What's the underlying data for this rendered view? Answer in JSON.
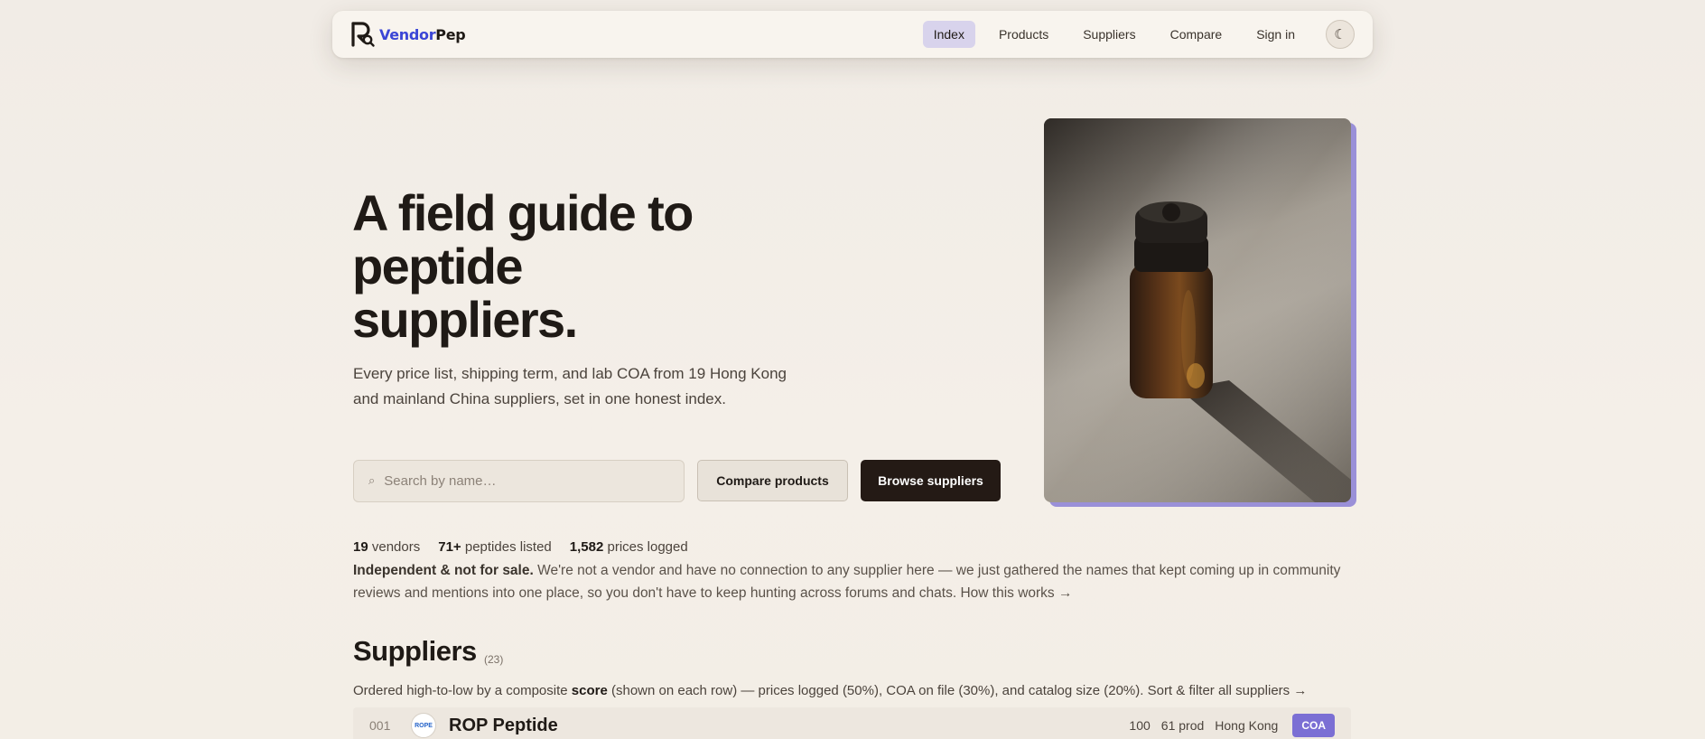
{
  "nav": {
    "brand_first": "Vendor",
    "brand_second": "Pep",
    "links": [
      {
        "label": "Index",
        "active": true
      },
      {
        "label": "Products"
      },
      {
        "label": "Suppliers"
      },
      {
        "label": "Compare"
      },
      {
        "label": "Sign in"
      }
    ],
    "theme_icon": "☾"
  },
  "hero": {
    "title_line1": "A field guide to",
    "title_line2": "peptide",
    "title_line3": "suppliers.",
    "subtitle": "Every price list, shipping term, and lab COA from 19 Hong Kong and mainland China suppliers, set in one honest index."
  },
  "search": {
    "icon": "⌕",
    "placeholder": "Search by name…"
  },
  "buttons": {
    "compare": "Compare products",
    "browse": "Browse suppliers"
  },
  "stats": {
    "vendors_value": "19",
    "vendors_label": "vendors",
    "peptides_value": "71+",
    "peptides_label": "peptides listed",
    "prices_value": "1,582",
    "prices_label": "prices logged"
  },
  "note": {
    "bold": "Independent & not for sale.",
    "text": " We're not a vendor and have no connection to any supplier here — we just gathered the names that kept coming up in community reviews and mentions into one place, so you don't have to keep hunting across forums and chats. ",
    "link": "How this works →"
  },
  "suppliers": {
    "title": "Suppliers",
    "count": "(23)",
    "desc_before": "Ordered high-to-low by a composite ",
    "desc_bold": "score",
    "desc_after": " (shown on each row) — prices logged (50%), COA on file (30%), and catalog size (20%). ",
    "desc_link": "Sort & filter all suppliers →",
    "rows": [
      {
        "num": "001",
        "logo_text": "ROPE",
        "name": "ROP Peptide",
        "score": "100",
        "products": "61 prod",
        "location": "Hong Kong",
        "badge": "COA"
      }
    ]
  },
  "colors": {
    "accent": "#3b46d6",
    "badge": "#7b6fd4",
    "dark_button": "#241a15",
    "active_nav": "#d8d3ec"
  }
}
